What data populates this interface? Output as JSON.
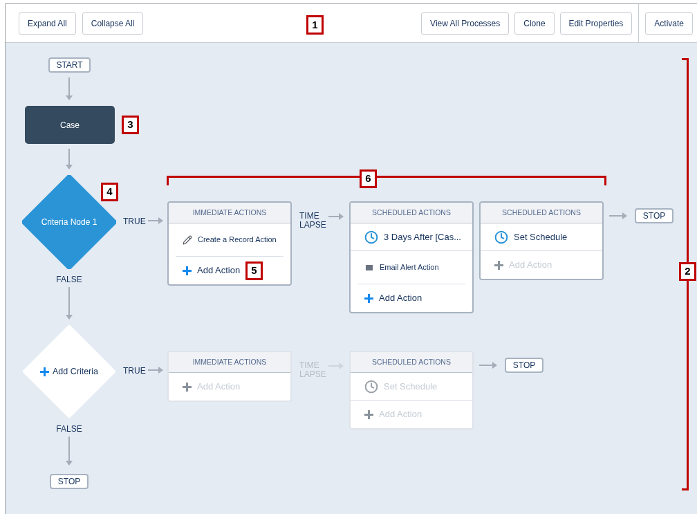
{
  "toolbar": {
    "left_buttons": [
      "Expand All",
      "Collapse All"
    ],
    "right_buttons": [
      "View All Processes",
      "Clone",
      "Edit Properties"
    ],
    "activate_button": "Activate"
  },
  "flow": {
    "start": "START",
    "object": "Case",
    "rows": [
      {
        "criteria": {
          "kind": "node",
          "label": "Criteria Node 1"
        },
        "true_label": "TRUE",
        "false_label": "FALSE",
        "disabled": false,
        "immediate": {
          "header": "IMMEDIATE ACTIONS",
          "actions": [
            {
              "kind": "record",
              "label": "Create a Record Action"
            },
            {
              "kind": "add",
              "label": "Add Action",
              "disabled": false
            }
          ]
        },
        "time_lapse": "TIME LAPSE",
        "scheduled": [
          {
            "header": "SCHEDULED ACTIONS",
            "schedule": {
              "label": "3 Days After [Cas...",
              "disabled": false
            },
            "actions": [
              {
                "kind": "email",
                "label": "Email Alert Action"
              },
              {
                "kind": "add",
                "label": "Add Action",
                "disabled": false
              }
            ]
          },
          {
            "header": "SCHEDULED ACTIONS",
            "schedule": {
              "label": "Set Schedule",
              "disabled": false
            },
            "actions": [
              {
                "kind": "add",
                "label": "Add Action",
                "disabled": true
              }
            ]
          }
        ],
        "stop": "STOP"
      },
      {
        "criteria": {
          "kind": "add",
          "label": "Add Criteria"
        },
        "true_label": "TRUE",
        "false_label": "FALSE",
        "disabled": true,
        "immediate": {
          "header": "IMMEDIATE ACTIONS",
          "actions": [
            {
              "kind": "add",
              "label": "Add Action",
              "disabled": true
            }
          ]
        },
        "time_lapse": "TIME LAPSE",
        "scheduled": [
          {
            "header": "SCHEDULED ACTIONS",
            "schedule": {
              "label": "Set Schedule",
              "disabled": true
            },
            "actions": [
              {
                "kind": "add",
                "label": "Add Action",
                "disabled": true
              }
            ]
          }
        ],
        "stop": "STOP"
      }
    ],
    "end_stop": "STOP"
  },
  "callouts": [
    {
      "label": "1"
    },
    {
      "label": "2"
    },
    {
      "label": "3"
    },
    {
      "label": "4"
    },
    {
      "label": "5"
    },
    {
      "label": "6"
    }
  ]
}
